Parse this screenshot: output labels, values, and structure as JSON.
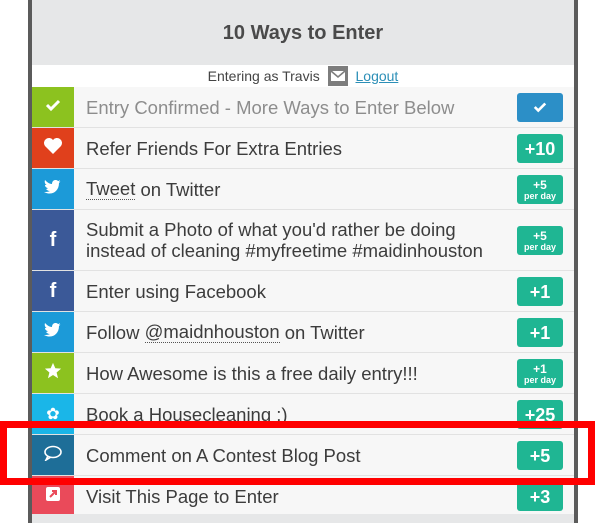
{
  "widget": {
    "title": "10 Ways to Enter",
    "login_prefix": "Entering as Travis",
    "logout_label": "Logout"
  },
  "entries": [
    {
      "label": "Entry Confirmed - More Ways to Enter Below",
      "badge": "✔",
      "icon": "check-icon",
      "color": "#8cc21f"
    },
    {
      "label": "Refer Friends For Extra Entries",
      "badge": "+10",
      "icon": "heart-icon",
      "color": "#e0401c"
    },
    {
      "label_link": "Tweet",
      "label_rest": " on Twitter",
      "badge": "+5",
      "badge_sub": "per day",
      "icon": "twitter-icon",
      "color": "#1c9ad8"
    },
    {
      "label": "Submit a Photo of what you'd rather be doing instead of cleaning #myfreetime #maidinhouston",
      "badge": "+5",
      "badge_sub": "per day",
      "icon": "facebook-icon",
      "color": "#3b5998"
    },
    {
      "label": "Enter using Facebook",
      "badge": "+1",
      "icon": "facebook-icon",
      "color": "#3b5998"
    },
    {
      "label_pre": "Follow ",
      "label_link": "@maidnhouston",
      "label_rest": " on Twitter",
      "badge": "+1",
      "icon": "twitter-icon",
      "color": "#1c9ad8"
    },
    {
      "label": "How Awesome is this a free daily entry!!!",
      "badge": "+1",
      "badge_sub": "per day",
      "icon": "star-icon",
      "color": "#8cc21f"
    },
    {
      "label": "Book a Housecleaning :)",
      "badge": "+25",
      "icon": "gear-icon",
      "color": "#1ab6e8"
    },
    {
      "label": "Comment on A Contest Blog Post",
      "badge": "+5",
      "icon": "comment-icon",
      "color": "#1e6e98"
    },
    {
      "label": "Visit This Page to Enter",
      "badge": "+3",
      "icon": "external-link-icon",
      "color": "#ea4a5a"
    }
  ]
}
